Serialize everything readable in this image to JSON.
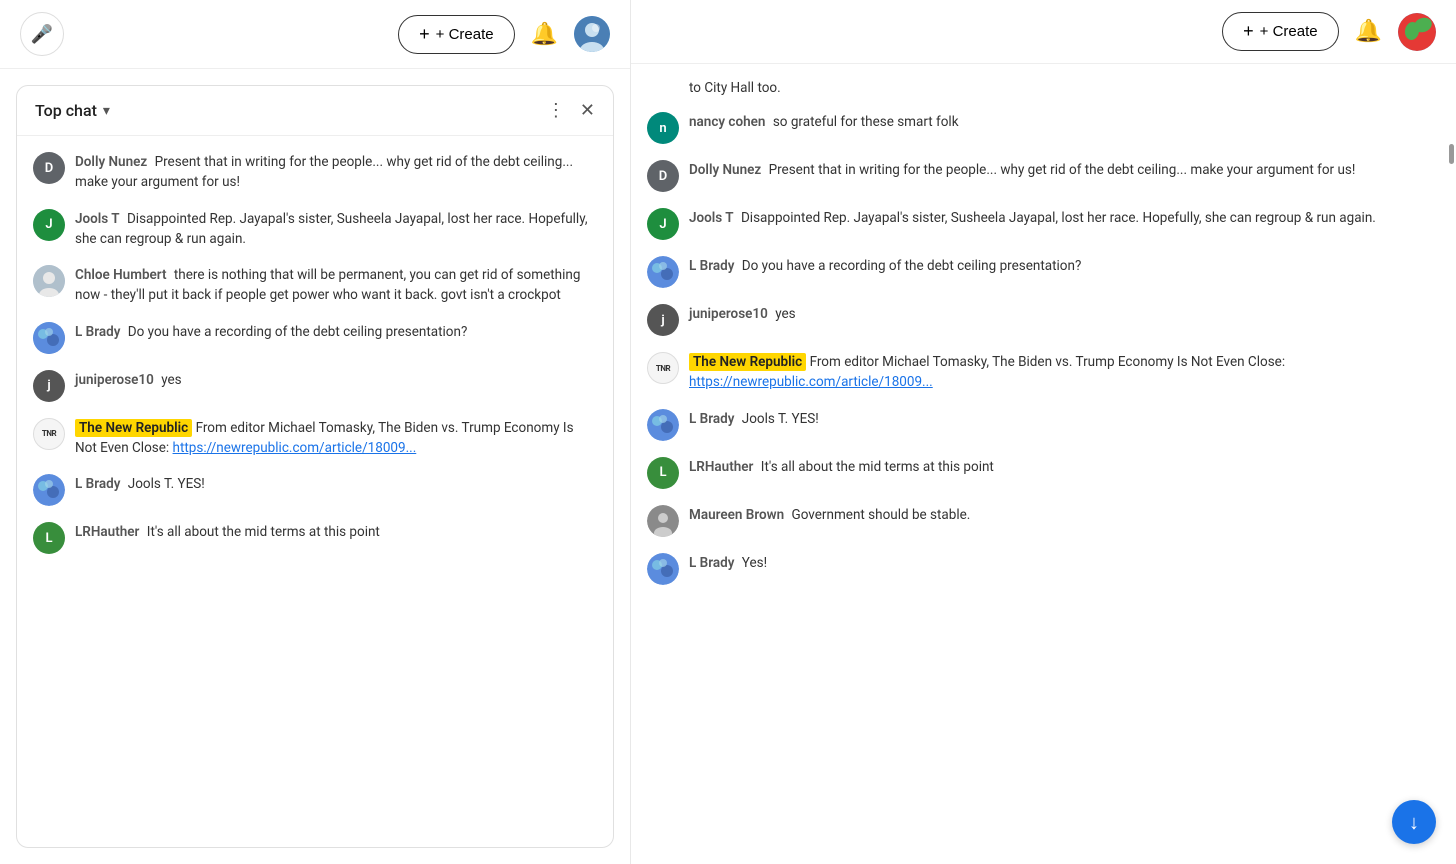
{
  "left_topbar": {
    "mic_label": "🎤",
    "create_label": "+ Create",
    "bell_label": "🔔"
  },
  "chat_header": {
    "title": "Top chat",
    "chevron": "▾",
    "more_icon": "⋮",
    "close_icon": "✕"
  },
  "left_messages": [
    {
      "id": "msg1",
      "username": "Dolly Nunez",
      "avatar_letter": "D",
      "avatar_class": "avatar-d",
      "text": "Present that in writing for the people... why get rid of the debt ceiling... make your argument for us!",
      "highlight": null,
      "link": null
    },
    {
      "id": "msg2",
      "username": "Jools T",
      "avatar_letter": "J",
      "avatar_class": "avatar-j",
      "text": "Disappointed Rep. Jayapal's sister, Susheela Jayapal, lost her race. Hopefully, she can regroup & run again.",
      "highlight": null,
      "link": null
    },
    {
      "id": "msg3",
      "username": "Chloe Humbert",
      "avatar_letter": "",
      "avatar_class": "avatar-photo-chloe",
      "text": "there is nothing that will be permanent, you can get rid of something now - they'll put it back if people get power who want it back. govt isn't a crockpot",
      "highlight": null,
      "link": null
    },
    {
      "id": "msg4",
      "username": "L Brady",
      "avatar_letter": "",
      "avatar_class": "avatar-photo-l-brady",
      "text": "Do you have a recording of the debt ceiling presentation?",
      "highlight": null,
      "link": null
    },
    {
      "id": "msg5",
      "username": "juniperose10",
      "avatar_letter": "j",
      "avatar_class": "avatar-ji",
      "text": "yes",
      "highlight": null,
      "link": null
    },
    {
      "id": "msg6",
      "username": "",
      "avatar_letter": "TNR",
      "avatar_class": "avatar-tnr",
      "highlight_label": "The New Republic",
      "text": " From editor Michael Tomasky, The Biden vs. Trump Economy Is Not Even Close: ",
      "link_text": "https://newrepublic.com/article/18009...",
      "link": "https://newrepublic.com/article/18009..."
    },
    {
      "id": "msg7",
      "username": "L Brady",
      "avatar_letter": "",
      "avatar_class": "avatar-photo-l-brady",
      "text": "Jools T. YES!",
      "highlight": null,
      "link": null
    },
    {
      "id": "msg8",
      "username": "LRHauther",
      "avatar_letter": "L",
      "avatar_class": "avatar-lrh",
      "text": "It's all about the mid terms at this point",
      "highlight": null,
      "link": null
    }
  ],
  "right_topbar": {
    "create_label": "+ Create",
    "bell_label": "🔔"
  },
  "right_messages": [
    {
      "id": "r0",
      "username": "",
      "avatar_letter": "",
      "avatar_class": "",
      "is_partial": true,
      "text": "to City Hall too."
    },
    {
      "id": "r1",
      "username": "nancy cohen",
      "avatar_letter": "n",
      "avatar_class": "avatar-j",
      "text": "so grateful for these smart folk",
      "highlight": null,
      "link": null
    },
    {
      "id": "r2",
      "username": "Dolly Nunez",
      "avatar_letter": "D",
      "avatar_class": "avatar-d",
      "text": "Present that in writing for the people... why get rid of the debt ceiling... make your argument for us!",
      "highlight": null,
      "link": null
    },
    {
      "id": "r3",
      "username": "Jools T",
      "avatar_letter": "J",
      "avatar_class": "avatar-j",
      "text": "Disappointed Rep. Jayapal's sister, Susheela Jayapal, lost her race. Hopefully, she can regroup & run again.",
      "highlight": null,
      "link": null
    },
    {
      "id": "r4",
      "username": "L Brady",
      "avatar_letter": "",
      "avatar_class": "avatar-photo-l-brady",
      "text": "Do you have a recording of the debt ceiling presentation?",
      "highlight": null,
      "link": null
    },
    {
      "id": "r5",
      "username": "juniperose10",
      "avatar_letter": "j",
      "avatar_class": "avatar-ji",
      "text": "yes",
      "highlight": null,
      "link": null
    },
    {
      "id": "r6",
      "username": "",
      "avatar_letter": "TNR",
      "avatar_class": "avatar-tnr",
      "highlight_label": "The New Republic",
      "text": " From editor Michael Tomasky, The Biden vs. Trump Economy Is Not Even Close: ",
      "link_text": "https://newrepublic.com/article/18009...",
      "link": "https://newrepublic.com/article/18009..."
    },
    {
      "id": "r7",
      "username": "L Brady",
      "avatar_letter": "",
      "avatar_class": "avatar-photo-l-brady",
      "text": "Jools T. YES!",
      "highlight": null,
      "link": null
    },
    {
      "id": "r8",
      "username": "LRHauther",
      "avatar_letter": "L",
      "avatar_class": "avatar-lrh",
      "text": "It's all about the mid terms at this point",
      "highlight": null,
      "link": null
    },
    {
      "id": "r9",
      "username": "Maureen Brown",
      "avatar_letter": "",
      "avatar_class": "avatar-photo-maureen",
      "text": "Government should be stable.",
      "highlight": null,
      "link": null
    },
    {
      "id": "r10",
      "username": "L Brady",
      "avatar_letter": "",
      "avatar_class": "avatar-photo-l-brady",
      "text": "Yes!",
      "highlight": null,
      "link": null
    }
  ],
  "scroll_down_icon": "↓"
}
